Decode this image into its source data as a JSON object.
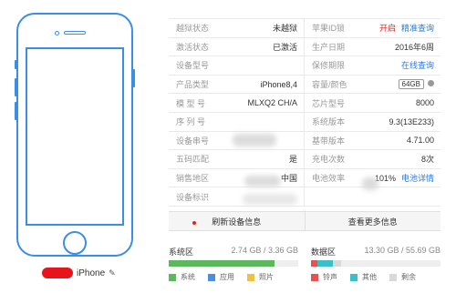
{
  "device": {
    "name": "iPhone",
    "edit_icon": "pencil-icon"
  },
  "info_rows": [
    {
      "lk": "越狱状态",
      "lv": "未越狱",
      "rk": "苹果ID锁",
      "rv": "开启",
      "rv_color": "red",
      "rlink": "精准查询"
    },
    {
      "lk": "激活状态",
      "lv": "已激活",
      "rk": "生产日期",
      "rv": "2016年6周",
      "rlink": ""
    },
    {
      "lk": "设备型号",
      "lv": "",
      "rk": "保修期限",
      "rv": "",
      "rlink": "在线查询"
    },
    {
      "lk": "产品类型",
      "lv": "iPhone8,4",
      "rk": "容量/颜色",
      "rv": "64GB",
      "rv_badge": true,
      "rdot": true
    },
    {
      "lk": "模 型 号",
      "lv": "MLXQ2 CH/A",
      "rk": "芯片型号",
      "rv": "8000",
      "rlink": ""
    },
    {
      "lk": "序 列 号",
      "lv": "",
      "rk": "系统版本",
      "rv": "9.3(13E233)",
      "rlink": ""
    },
    {
      "lk": "设备串号",
      "lv": "",
      "rk": "基带版本",
      "rv": "4.71.00",
      "rlink": ""
    },
    {
      "lk": "五码匹配",
      "lv": "是",
      "rk": "充电次数",
      "rv": "8次",
      "rlink": ""
    },
    {
      "lk": "销售地区",
      "lv": "中国",
      "rk": "电池效率",
      "rv": "101%",
      "rlink": "电池详情"
    },
    {
      "lk": "设备标识",
      "lv": "",
      "rk": "",
      "rv": "",
      "rlink": ""
    }
  ],
  "actions": {
    "refresh": "刷新设备信息",
    "more": "查看更多信息"
  },
  "system_storage": {
    "label": "系统区",
    "usage": "2.74 GB / 3.36 GB",
    "used_fraction": 0.815,
    "legend": [
      "系统",
      "应用",
      "照片"
    ],
    "colors": [
      "#5cb85c",
      "#4a90e2",
      "#f0c040"
    ]
  },
  "data_storage": {
    "label": "数据区",
    "usage": "13.30 GB / 55.69 GB",
    "legend": [
      "铃声",
      "其他",
      "剩余"
    ],
    "colors": [
      "#e8514f",
      "#3cc0c8",
      "#d9d9d9"
    ],
    "segments": [
      0.05,
      0.12,
      0.06
    ]
  }
}
